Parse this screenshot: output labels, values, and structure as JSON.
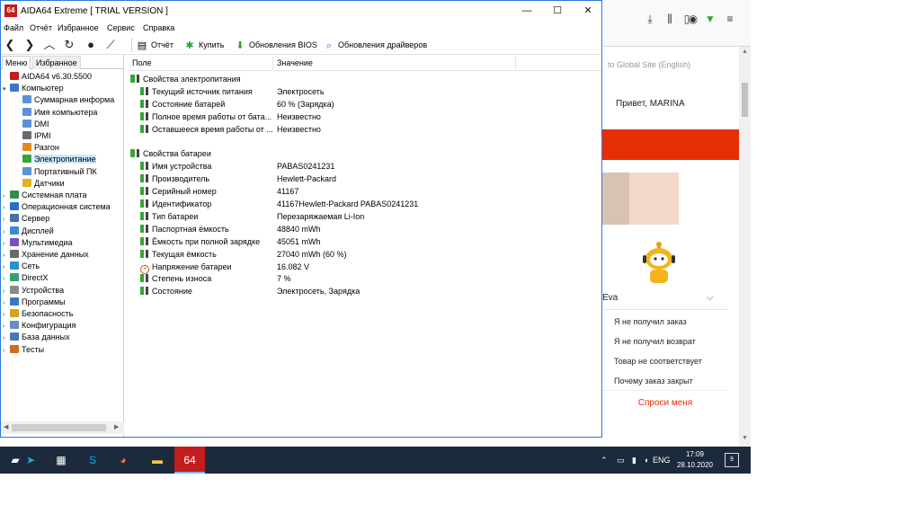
{
  "window": {
    "app_icon": "64",
    "title": "AIDA64 Extreme  [ TRIAL VERSION ]"
  },
  "menu": [
    "Файл",
    "Отчёт",
    "Избранное",
    "Сервис",
    "Справка"
  ],
  "toolbar": {
    "report": "Отчёт",
    "buy": "Купить",
    "bios_update": "Обновления BIOS",
    "driver_update": "Обновления драйверов"
  },
  "left_panel": {
    "tabs": [
      "Меню",
      "Избранное"
    ],
    "tree": [
      {
        "label": "AIDA64 v6.30.5500",
        "level": 0,
        "icon": "#c41d1d",
        "exp": ""
      },
      {
        "label": "Компьютер",
        "level": 0,
        "icon": "#3b78c4",
        "exp": "▾"
      },
      {
        "label": "Суммарная информа",
        "level": 1,
        "icon": "#5b92d6",
        "exp": ""
      },
      {
        "label": "Имя компьютера",
        "level": 1,
        "icon": "#5b92d6",
        "exp": ""
      },
      {
        "label": "DMI",
        "level": 1,
        "icon": "#5b92d6",
        "exp": ""
      },
      {
        "label": "IPMI",
        "level": 1,
        "icon": "#6a6a6a",
        "exp": ""
      },
      {
        "label": "Разгон",
        "level": 1,
        "icon": "#e08a1e",
        "exp": ""
      },
      {
        "label": "Электропитание",
        "level": 1,
        "icon": "#36a536",
        "exp": "",
        "selected": true
      },
      {
        "label": "Портативный ПК",
        "level": 1,
        "icon": "#5b92d6",
        "exp": ""
      },
      {
        "label": "Датчики",
        "level": 1,
        "icon": "#e0b21e",
        "exp": ""
      },
      {
        "label": "Системная плата",
        "level": 0,
        "icon": "#2f8f4f",
        "exp": "›"
      },
      {
        "label": "Операционная система",
        "level": 0,
        "icon": "#2b6fce",
        "exp": "›"
      },
      {
        "label": "Сервер",
        "level": 0,
        "icon": "#4b6ea8",
        "exp": "›"
      },
      {
        "label": "Дисплей",
        "level": 0,
        "icon": "#3b8bd4",
        "exp": "›"
      },
      {
        "label": "Мультимедиа",
        "level": 0,
        "icon": "#7a4fc4",
        "exp": "›"
      },
      {
        "label": "Хранение данных",
        "level": 0,
        "icon": "#6a6a6a",
        "exp": "›"
      },
      {
        "label": "Сеть",
        "level": 0,
        "icon": "#2b8fd4",
        "exp": "›"
      },
      {
        "label": "DirectX",
        "level": 0,
        "icon": "#2fa36b",
        "exp": "›"
      },
      {
        "label": "Устройства",
        "level": 0,
        "icon": "#8a8a8a",
        "exp": "›"
      },
      {
        "label": "Программы",
        "level": 0,
        "icon": "#3b78c4",
        "exp": "›"
      },
      {
        "label": "Безопасность",
        "level": 0,
        "icon": "#d4a21e",
        "exp": "›"
      },
      {
        "label": "Конфигурация",
        "level": 0,
        "icon": "#6a8ac4",
        "exp": "›"
      },
      {
        "label": "База данных",
        "level": 0,
        "icon": "#4a78b4",
        "exp": "›"
      },
      {
        "label": "Тесты",
        "level": 0,
        "icon": "#d46a1e",
        "exp": "›"
      }
    ]
  },
  "right_panel": {
    "columns": [
      "Поле",
      "Значение"
    ],
    "rows": [
      {
        "kind": "group",
        "field": "Свойства электропитания",
        "value": ""
      },
      {
        "kind": "item",
        "field": "Текущий источник питания",
        "value": "Электросеть",
        "icon": "bat"
      },
      {
        "kind": "item",
        "field": "Состояние батарей",
        "value": "60 % (Зарядка)",
        "icon": "bat"
      },
      {
        "kind": "item",
        "field": "Полное время работы от бата...",
        "value": "Неизвестно",
        "icon": "bat"
      },
      {
        "kind": "item",
        "field": "Оставшееся время работы от ...",
        "value": "Неизвестно",
        "icon": "bat"
      },
      {
        "kind": "spacer",
        "field": "",
        "value": ""
      },
      {
        "kind": "group",
        "field": "Свойства батареи",
        "value": ""
      },
      {
        "kind": "item",
        "field": "Имя устройства",
        "value": "PABAS0241231",
        "icon": "bat"
      },
      {
        "kind": "item",
        "field": "Производитель",
        "value": "Hewlett-Packard",
        "icon": "bat"
      },
      {
        "kind": "item",
        "field": "Серийный номер",
        "value": "41167",
        "icon": "bat"
      },
      {
        "kind": "item",
        "field": "Идентификатор",
        "value": "41167Hewlett-Packard PABAS0241231",
        "icon": "bat"
      },
      {
        "kind": "item",
        "field": "Тип батареи",
        "value": "Перезаряжаемая Li-Ion",
        "icon": "bat"
      },
      {
        "kind": "item",
        "field": "Паспортная ёмкость",
        "value": "48840 mWh",
        "icon": "bat"
      },
      {
        "kind": "item",
        "field": "Ёмкость при полной зарядке",
        "value": "45051 mWh",
        "icon": "bat"
      },
      {
        "kind": "item",
        "field": "Текущая ёмкость",
        "value": "27040 mWh  (60 %)",
        "icon": "bat"
      },
      {
        "kind": "item",
        "field": "Напряжение батареи",
        "value": "16.082 V",
        "icon": "volt"
      },
      {
        "kind": "item",
        "field": "Степень износа",
        "value": "7 %",
        "icon": "bat"
      },
      {
        "kind": "item",
        "field": "Состояние",
        "value": "Электросеть, Зарядка",
        "icon": "bat"
      }
    ]
  },
  "browser": {
    "global_site": "to Global Site (English)",
    "greeting": "Привет, MARINA",
    "chat_name": "Eva",
    "chat_items": [
      "Я не получил заказ",
      "Я не получил возврат",
      "Товар не соответствует",
      "Почему заказ закрыт"
    ],
    "ask_me": "Спроси меня"
  },
  "taskbar": {
    "aida_label": "64",
    "lang": "ENG",
    "time": "17:09",
    "date": "28.10.2020",
    "notif_count": "9"
  }
}
